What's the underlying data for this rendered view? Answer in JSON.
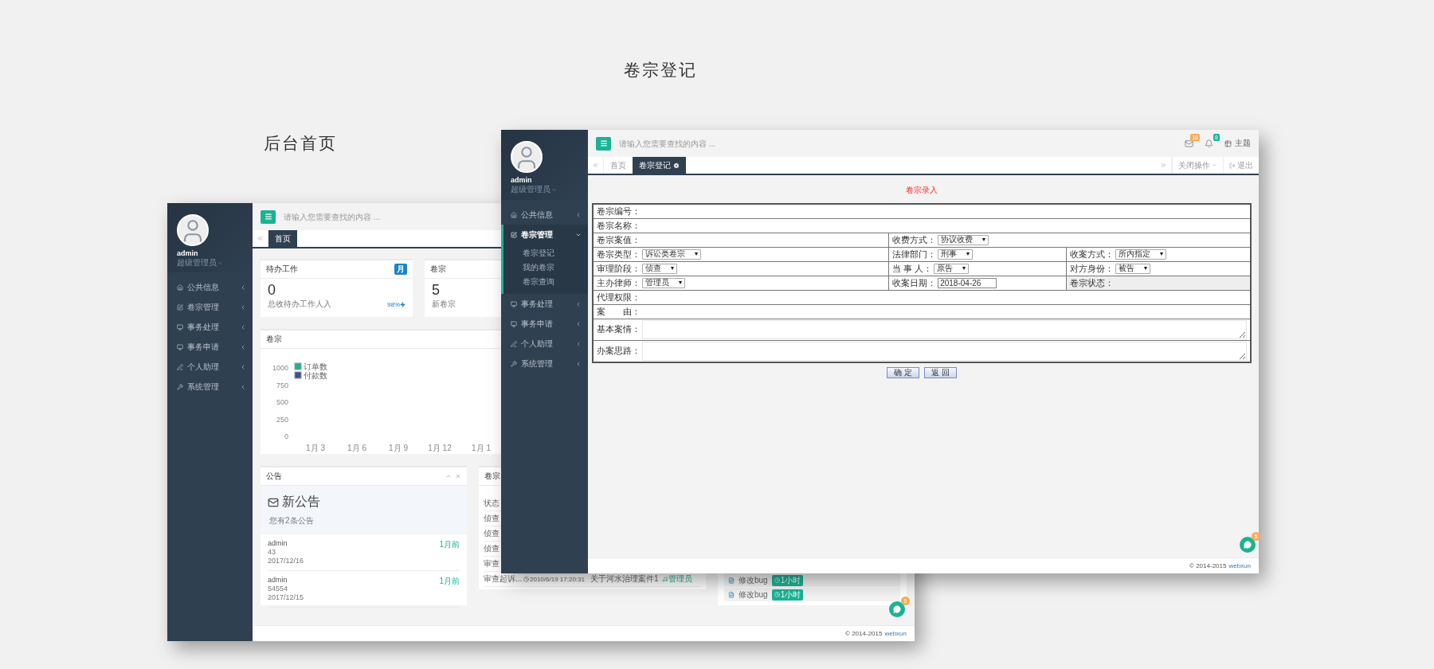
{
  "captions": [
    {
      "text": "卷宗登记"
    },
    {
      "text": "后台首页"
    }
  ],
  "front_window": {
    "sidebar": {
      "user": {
        "name": "admin",
        "role": "超级管理员"
      },
      "menu": [
        {
          "label": "公共信息",
          "expanded": false
        },
        {
          "label": "卷宗管理",
          "expanded": true,
          "children": [
            {
              "label": "卷宗登记"
            },
            {
              "label": "我的卷宗"
            },
            {
              "label": "卷宗查询"
            }
          ]
        },
        {
          "label": "事务处理",
          "expanded": false
        },
        {
          "label": "事务申请",
          "expanded": false
        },
        {
          "label": "个人助理",
          "expanded": false
        },
        {
          "label": "系统管理",
          "expanded": false
        }
      ]
    },
    "search": {
      "placeholder": "请输入您需要查找的内容 ..."
    },
    "notifications": [
      {
        "count": "16",
        "color": "#f8ac59"
      },
      {
        "count": "8",
        "color": "#1ab394"
      }
    ],
    "theme_label": "主题",
    "tabs": [
      {
        "label": "首页",
        "selected": false,
        "closable": false
      },
      {
        "label": "卷宗登记",
        "selected": true,
        "closable": true
      }
    ],
    "tab_tools": {
      "close_menu": "关闭操作",
      "logout": "退出"
    },
    "form": {
      "title": "卷宗录入",
      "rows": [
        [
          {
            "label": "卷宗编号：",
            "kind": "text",
            "colspan": 3
          }
        ],
        [
          {
            "label": "卷宗名称：",
            "kind": "text",
            "colspan": 3
          }
        ],
        [
          {
            "label": "卷宗案值：",
            "kind": "text"
          },
          {
            "label": "收费方式：",
            "kind": "select",
            "value": "协议收费",
            "colspan": 2
          }
        ],
        [
          {
            "label": "卷宗类型：",
            "kind": "select",
            "value": "诉讼类卷宗"
          },
          {
            "label": "法律部门：",
            "kind": "select",
            "value": "刑事"
          },
          {
            "label": "收案方式：",
            "kind": "select",
            "value": "所内指定"
          }
        ],
        [
          {
            "label": "审理阶段：",
            "kind": "select",
            "value": "侦查"
          },
          {
            "label": "当 事 人：",
            "kind": "select",
            "value": "原告"
          },
          {
            "label": "对方身份：",
            "kind": "select",
            "value": "被告"
          }
        ],
        [
          {
            "label": "主办律师：",
            "kind": "select",
            "value": "管理员"
          },
          {
            "label": "收案日期：",
            "kind": "date",
            "value": "2018-04-26"
          },
          {
            "label": "卷宗状态：",
            "kind": "readonly"
          }
        ],
        [
          {
            "label": "代理权限：",
            "kind": "text",
            "colspan": 3
          }
        ],
        [
          {
            "label": "案　　由：",
            "kind": "text",
            "colspan": 3
          }
        ],
        [
          {
            "label": "基本案情：",
            "kind": "textarea",
            "colspan": 3
          }
        ],
        [
          {
            "label": "办案思路：",
            "kind": "textarea",
            "colspan": 3
          }
        ]
      ],
      "buttons": [
        "确 定",
        "返 回"
      ]
    },
    "chat": {
      "badge": "5"
    },
    "footer": {
      "copyright": "© 2014-2015",
      "link": "webxun"
    }
  },
  "back_window": {
    "sidebar": {
      "user": {
        "name": "admin",
        "role": "超级管理员"
      },
      "menu": [
        {
          "label": "公共信息",
          "expanded": false
        },
        {
          "label": "卷宗管理",
          "expanded": false
        },
        {
          "label": "事务处理",
          "expanded": false
        },
        {
          "label": "事务申请",
          "expanded": false
        },
        {
          "label": "个人助理",
          "expanded": false
        },
        {
          "label": "系统管理",
          "expanded": false
        }
      ]
    },
    "search": {
      "placeholder": "请输入您需要查找的内容 ..."
    },
    "tabs": [
      {
        "label": "首页",
        "selected": true
      }
    ],
    "stat_cards": [
      {
        "title": "待办工作",
        "badge": "月",
        "value": "0",
        "caption": "总收待办工作人入",
        "trend": "98%"
      },
      {
        "title": "卷宗",
        "value": "5",
        "caption": "新卷宗"
      }
    ],
    "chart_card": {
      "title": "卷宗",
      "chart_data": {
        "type": "line",
        "categories": [
          "1月 3",
          "1月 6",
          "1月 9",
          "1月 12",
          "1月 1"
        ],
        "ylim": [
          0,
          1000
        ],
        "yticks": [
          0,
          250,
          500,
          750,
          1000
        ],
        "series": [
          {
            "name": "订单数",
            "color": "#1ab394",
            "values": [
              null,
              null,
              null,
              null,
              null
            ]
          },
          {
            "name": "付款数",
            "color": "#464f88",
            "values": [
              null,
              null,
              null,
              null,
              null
            ]
          }
        ]
      }
    },
    "notice_card": {
      "title": "公告",
      "headline": "新公告",
      "summary": "您有2条公告",
      "items": [
        {
          "author": "admin",
          "content": "43",
          "date": "2017/12/16",
          "ago": "1月前"
        },
        {
          "author": "admin",
          "content": "54554",
          "date": "2017/12/15",
          "ago": "1月前"
        }
      ]
    },
    "case_list_card": {
      "title": "卷宗",
      "rows": [
        [
          "状态"
        ],
        [
          "侦查"
        ],
        [
          "侦查"
        ],
        [
          "侦查"
        ],
        [
          "审查"
        ],
        [
          "审查起诉...",
          "2010/6/19 17:20:31",
          "关于河水治理案件1",
          "管理员"
        ]
      ]
    },
    "task_card": {
      "items": [
        {
          "label": "修改bug",
          "time": "1小时"
        },
        {
          "label": "修改bug",
          "time": "1小时"
        }
      ]
    },
    "chat": {
      "badge": "5"
    },
    "footer": {
      "copyright": "© 2014-2015",
      "link": "webxun"
    }
  }
}
